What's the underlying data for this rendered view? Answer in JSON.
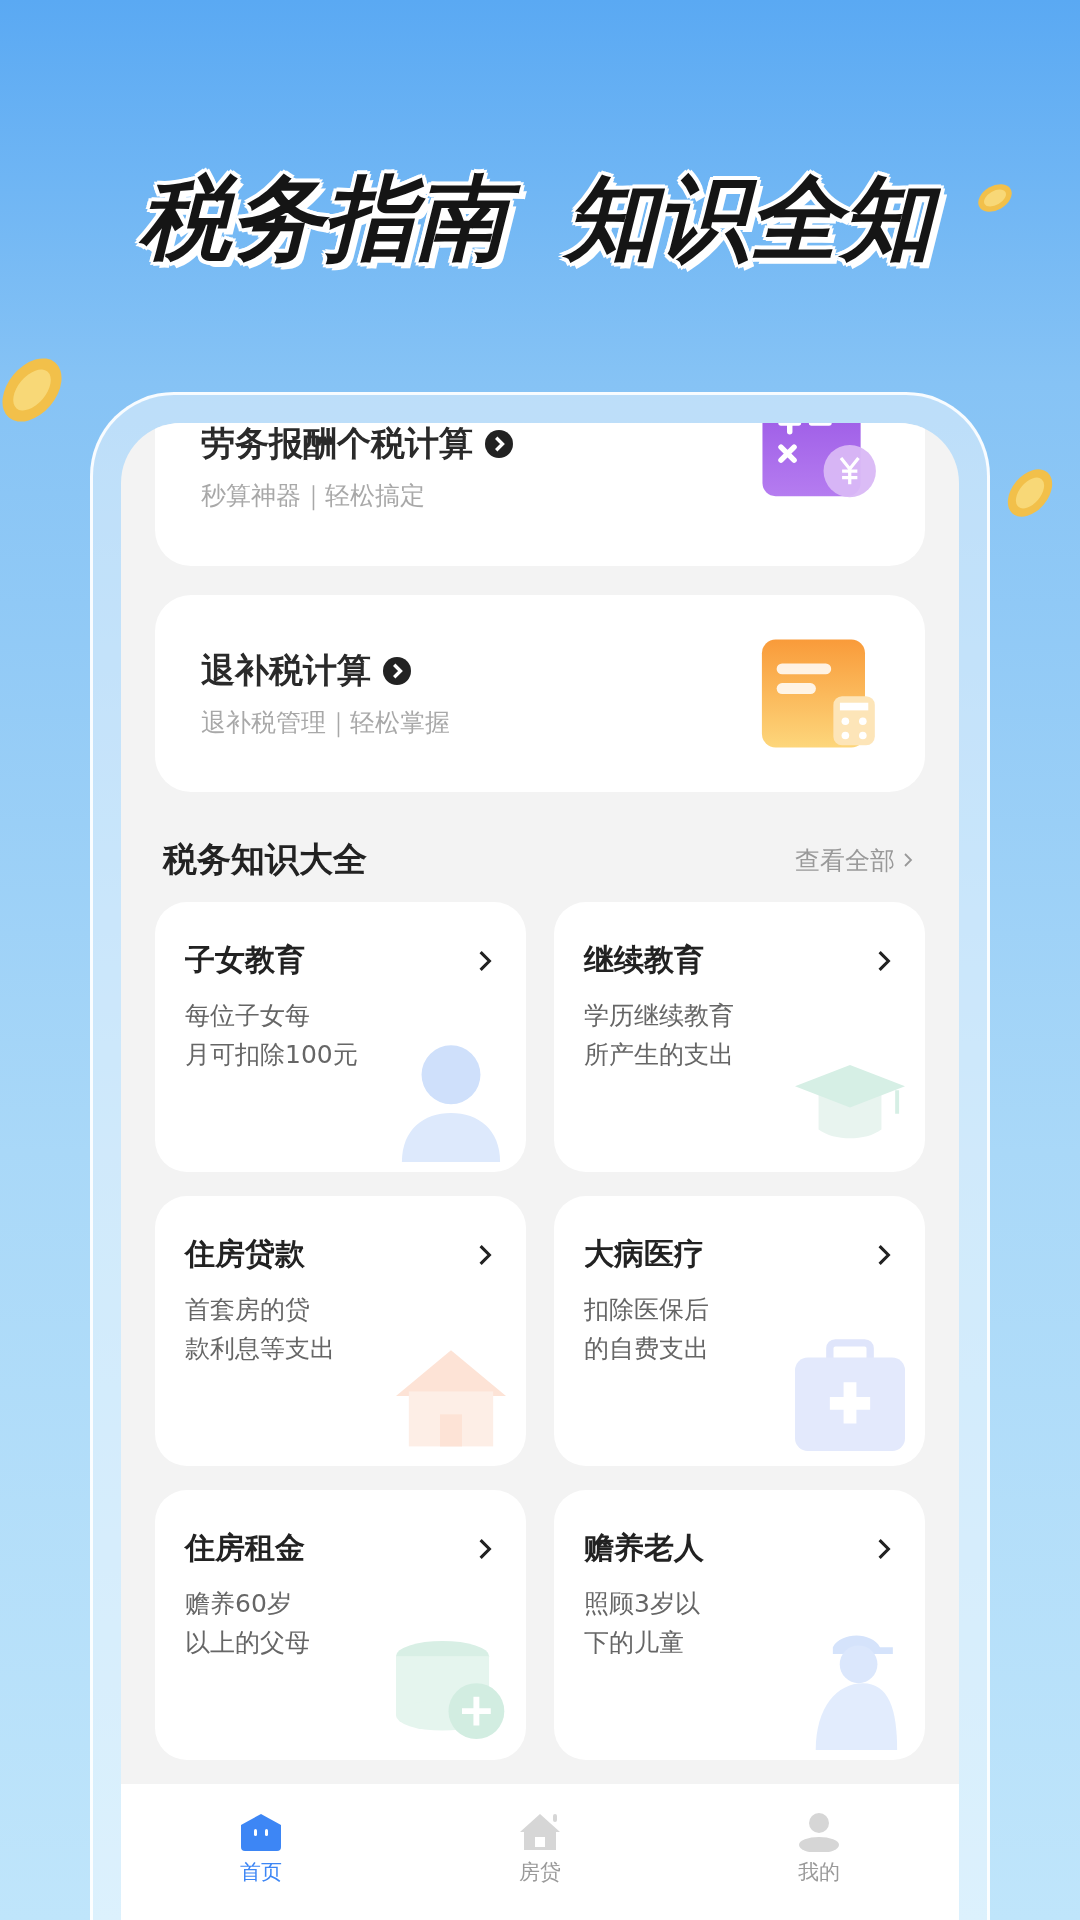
{
  "headline": [
    "税务指南",
    "知识全知"
  ],
  "tools": [
    {
      "title": "劳务报酬个税计算",
      "subtitle": "秒算神器｜轻松搞定",
      "kind": "calculator"
    },
    {
      "title": "退补税计算",
      "subtitle": "退补税管理｜轻松掌握",
      "kind": "sheet"
    }
  ],
  "section": {
    "title": "税务知识大全",
    "more": "查看全部"
  },
  "topics": [
    {
      "title": "子女教育",
      "description": [
        "每位子女每",
        "月可扣除100元"
      ],
      "kind": "person"
    },
    {
      "title": "继续教育",
      "description": [
        "学历继续教育",
        "所产生的支出"
      ],
      "kind": "cap"
    },
    {
      "title": "住房贷款",
      "description": [
        "首套房的贷",
        "款利息等支出"
      ],
      "kind": "house"
    },
    {
      "title": "大病医疗",
      "description": [
        "扣除医保后",
        "的自费支出"
      ],
      "kind": "medkit"
    },
    {
      "title": "住房租金",
      "description": [
        "赡养60岁",
        "以上的父母"
      ],
      "kind": "coins"
    },
    {
      "title": "赡养老人",
      "description": [
        "照顾3岁以",
        "下的儿童"
      ],
      "kind": "elder"
    }
  ],
  "nav": [
    {
      "label": "首页",
      "selected": true,
      "kind": "home"
    },
    {
      "label": "房贷",
      "selected": false,
      "kind": "house"
    },
    {
      "label": "我的",
      "selected": false,
      "kind": "profile"
    }
  ]
}
